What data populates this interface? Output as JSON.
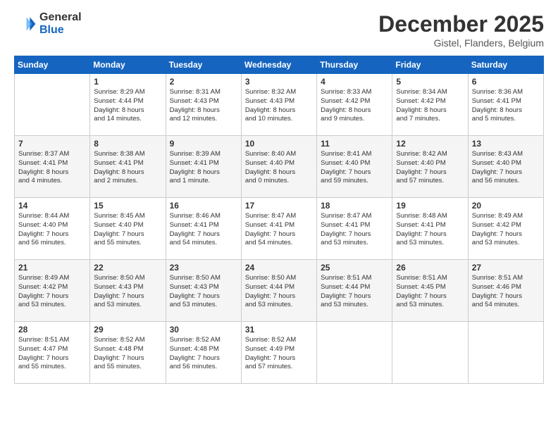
{
  "logo": {
    "general": "General",
    "blue": "Blue"
  },
  "header": {
    "month": "December 2025",
    "location": "Gistel, Flanders, Belgium"
  },
  "days": [
    "Sunday",
    "Monday",
    "Tuesday",
    "Wednesday",
    "Thursday",
    "Friday",
    "Saturday"
  ],
  "weeks": [
    [
      {
        "day": "",
        "content": ""
      },
      {
        "day": "1",
        "content": "Sunrise: 8:29 AM\nSunset: 4:44 PM\nDaylight: 8 hours\nand 14 minutes."
      },
      {
        "day": "2",
        "content": "Sunrise: 8:31 AM\nSunset: 4:43 PM\nDaylight: 8 hours\nand 12 minutes."
      },
      {
        "day": "3",
        "content": "Sunrise: 8:32 AM\nSunset: 4:43 PM\nDaylight: 8 hours\nand 10 minutes."
      },
      {
        "day": "4",
        "content": "Sunrise: 8:33 AM\nSunset: 4:42 PM\nDaylight: 8 hours\nand 9 minutes."
      },
      {
        "day": "5",
        "content": "Sunrise: 8:34 AM\nSunset: 4:42 PM\nDaylight: 8 hours\nand 7 minutes."
      },
      {
        "day": "6",
        "content": "Sunrise: 8:36 AM\nSunset: 4:41 PM\nDaylight: 8 hours\nand 5 minutes."
      }
    ],
    [
      {
        "day": "7",
        "content": "Sunrise: 8:37 AM\nSunset: 4:41 PM\nDaylight: 8 hours\nand 4 minutes."
      },
      {
        "day": "8",
        "content": "Sunrise: 8:38 AM\nSunset: 4:41 PM\nDaylight: 8 hours\nand 2 minutes."
      },
      {
        "day": "9",
        "content": "Sunrise: 8:39 AM\nSunset: 4:41 PM\nDaylight: 8 hours\nand 1 minute."
      },
      {
        "day": "10",
        "content": "Sunrise: 8:40 AM\nSunset: 4:40 PM\nDaylight: 8 hours\nand 0 minutes."
      },
      {
        "day": "11",
        "content": "Sunrise: 8:41 AM\nSunset: 4:40 PM\nDaylight: 7 hours\nand 59 minutes."
      },
      {
        "day": "12",
        "content": "Sunrise: 8:42 AM\nSunset: 4:40 PM\nDaylight: 7 hours\nand 57 minutes."
      },
      {
        "day": "13",
        "content": "Sunrise: 8:43 AM\nSunset: 4:40 PM\nDaylight: 7 hours\nand 56 minutes."
      }
    ],
    [
      {
        "day": "14",
        "content": "Sunrise: 8:44 AM\nSunset: 4:40 PM\nDaylight: 7 hours\nand 56 minutes."
      },
      {
        "day": "15",
        "content": "Sunrise: 8:45 AM\nSunset: 4:40 PM\nDaylight: 7 hours\nand 55 minutes."
      },
      {
        "day": "16",
        "content": "Sunrise: 8:46 AM\nSunset: 4:41 PM\nDaylight: 7 hours\nand 54 minutes."
      },
      {
        "day": "17",
        "content": "Sunrise: 8:47 AM\nSunset: 4:41 PM\nDaylight: 7 hours\nand 54 minutes."
      },
      {
        "day": "18",
        "content": "Sunrise: 8:47 AM\nSunset: 4:41 PM\nDaylight: 7 hours\nand 53 minutes."
      },
      {
        "day": "19",
        "content": "Sunrise: 8:48 AM\nSunset: 4:41 PM\nDaylight: 7 hours\nand 53 minutes."
      },
      {
        "day": "20",
        "content": "Sunrise: 8:49 AM\nSunset: 4:42 PM\nDaylight: 7 hours\nand 53 minutes."
      }
    ],
    [
      {
        "day": "21",
        "content": "Sunrise: 8:49 AM\nSunset: 4:42 PM\nDaylight: 7 hours\nand 53 minutes."
      },
      {
        "day": "22",
        "content": "Sunrise: 8:50 AM\nSunset: 4:43 PM\nDaylight: 7 hours\nand 53 minutes."
      },
      {
        "day": "23",
        "content": "Sunrise: 8:50 AM\nSunset: 4:43 PM\nDaylight: 7 hours\nand 53 minutes."
      },
      {
        "day": "24",
        "content": "Sunrise: 8:50 AM\nSunset: 4:44 PM\nDaylight: 7 hours\nand 53 minutes."
      },
      {
        "day": "25",
        "content": "Sunrise: 8:51 AM\nSunset: 4:44 PM\nDaylight: 7 hours\nand 53 minutes."
      },
      {
        "day": "26",
        "content": "Sunrise: 8:51 AM\nSunset: 4:45 PM\nDaylight: 7 hours\nand 53 minutes."
      },
      {
        "day": "27",
        "content": "Sunrise: 8:51 AM\nSunset: 4:46 PM\nDaylight: 7 hours\nand 54 minutes."
      }
    ],
    [
      {
        "day": "28",
        "content": "Sunrise: 8:51 AM\nSunset: 4:47 PM\nDaylight: 7 hours\nand 55 minutes."
      },
      {
        "day": "29",
        "content": "Sunrise: 8:52 AM\nSunset: 4:48 PM\nDaylight: 7 hours\nand 55 minutes."
      },
      {
        "day": "30",
        "content": "Sunrise: 8:52 AM\nSunset: 4:48 PM\nDaylight: 7 hours\nand 56 minutes."
      },
      {
        "day": "31",
        "content": "Sunrise: 8:52 AM\nSunset: 4:49 PM\nDaylight: 7 hours\nand 57 minutes."
      },
      {
        "day": "",
        "content": ""
      },
      {
        "day": "",
        "content": ""
      },
      {
        "day": "",
        "content": ""
      }
    ]
  ]
}
